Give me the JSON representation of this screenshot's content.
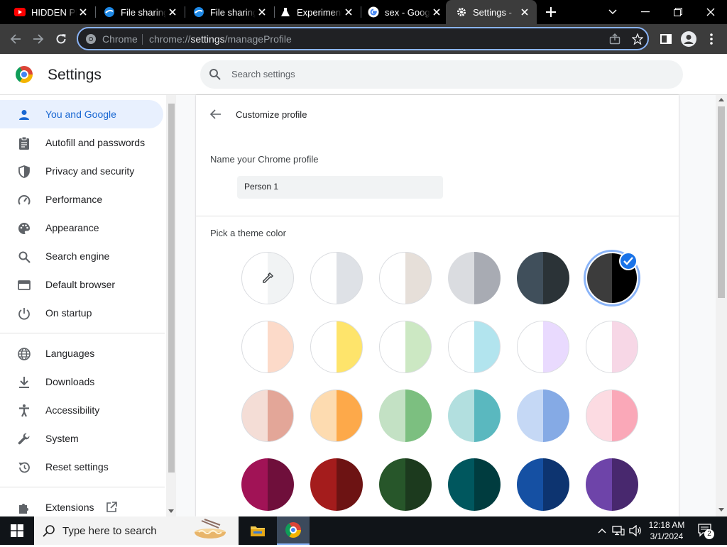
{
  "tabs": [
    {
      "title": "HIDDEN PL",
      "icon": "youtube-icon"
    },
    {
      "title": "File sharing",
      "icon": "filesharing-icon"
    },
    {
      "title": "File sharing",
      "icon": "filesharing-icon"
    },
    {
      "title": "Experiment",
      "icon": "flask-icon"
    },
    {
      "title": "sex - Google",
      "icon": "google-icon"
    },
    {
      "title": "Settings - ",
      "icon": "gear-icon",
      "active": true
    }
  ],
  "omnibox": {
    "chip": "Chrome",
    "url_prefix": "chrome://",
    "url_host": "settings",
    "url_path": "/manageProfile"
  },
  "header": {
    "title": "Settings",
    "search_placeholder": "Search settings"
  },
  "sidebar": {
    "items": [
      {
        "label": "You and Google",
        "icon": "person-icon",
        "selected": true
      },
      {
        "label": "Autofill and passwords",
        "icon": "clipboard-icon"
      },
      {
        "label": "Privacy and security",
        "icon": "shield-icon"
      },
      {
        "label": "Performance",
        "icon": "speedometer-icon"
      },
      {
        "label": "Appearance",
        "icon": "palette-icon"
      },
      {
        "label": "Search engine",
        "icon": "search-icon"
      },
      {
        "label": "Default browser",
        "icon": "browser-window-icon"
      },
      {
        "label": "On startup",
        "icon": "power-icon"
      },
      {
        "label": "Languages",
        "icon": "globe-icon"
      },
      {
        "label": "Downloads",
        "icon": "download-icon"
      },
      {
        "label": "Accessibility",
        "icon": "accessibility-icon"
      },
      {
        "label": "System",
        "icon": "wrench-icon"
      },
      {
        "label": "Reset settings",
        "icon": "reset-icon"
      },
      {
        "label": "Extensions",
        "icon": "puzzle-icon"
      }
    ]
  },
  "main": {
    "subtitle": "Customize profile",
    "name_label": "Name your Chrome profile",
    "name_value": "Person 1",
    "theme_label": "Pick a theme color",
    "swatches": [
      {
        "left": "#ffffff",
        "right": "#f1f3f4",
        "custom": true
      },
      {
        "left": "#ffffff",
        "right": "#dee1e6"
      },
      {
        "left": "#ffffff",
        "right": "#e6dfd9"
      },
      {
        "left": "#dadce0",
        "right": "#a8abb3"
      },
      {
        "left": "#404f5b",
        "right": "#2b3337"
      },
      {
        "left": "#3c3c3c",
        "right": "#000000",
        "selected": true
      },
      {
        "left": "#ffffff",
        "right": "#fcdac9"
      },
      {
        "left": "#ffffff",
        "right": "#fee46b"
      },
      {
        "left": "#ffffff",
        "right": "#cce8c3"
      },
      {
        "left": "#ffffff",
        "right": "#b2e4ee"
      },
      {
        "left": "#ffffff",
        "right": "#e9dafe"
      },
      {
        "left": "#ffffff",
        "right": "#f7d7e6"
      },
      {
        "left": "#f4ddd6",
        "right": "#e3a698"
      },
      {
        "left": "#fddbb0",
        "right": "#fda94a"
      },
      {
        "left": "#c3e1c4",
        "right": "#7cbf80"
      },
      {
        "left": "#b2dfdf",
        "right": "#5ab8bf"
      },
      {
        "left": "#c5d8f5",
        "right": "#85aae5"
      },
      {
        "left": "#fcdbe2",
        "right": "#faa8b8"
      },
      {
        "left": "#a11356",
        "right": "#6f0f3b"
      },
      {
        "left": "#a41c1c",
        "right": "#6d1313"
      },
      {
        "left": "#27562a",
        "right": "#1c3a1e"
      },
      {
        "left": "#00575e",
        "right": "#003c3f"
      },
      {
        "left": "#1550a3",
        "right": "#0d3470"
      },
      {
        "left": "#6e44a9",
        "right": "#48286e"
      }
    ]
  },
  "taskbar": {
    "search_placeholder": "Type here to search",
    "time": "12:18 AM",
    "date": "3/1/2024",
    "notification_count": "2"
  },
  "colors": {
    "accent": "#1a73e8",
    "selected_nav_bg": "#e8f0fe",
    "selected_nav_text": "#1967d2"
  }
}
